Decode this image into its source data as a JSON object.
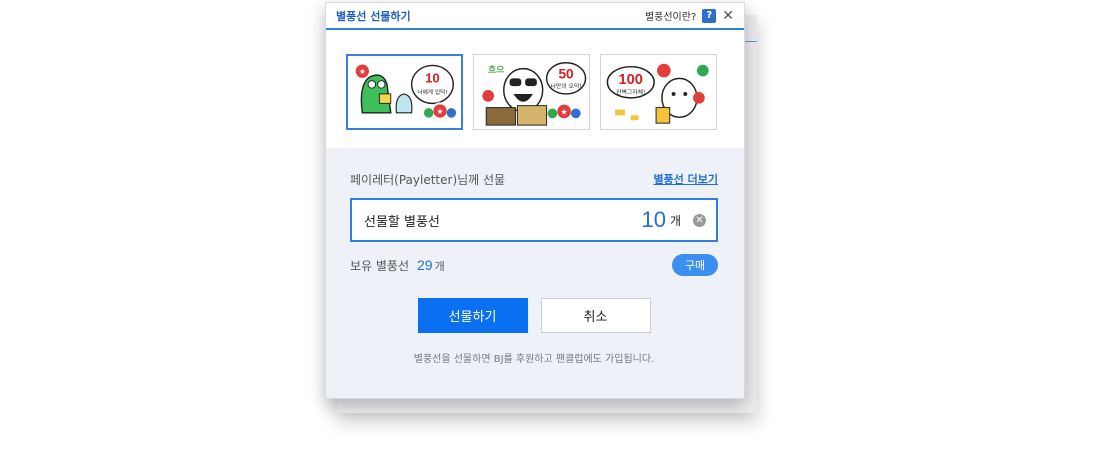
{
  "dialog": {
    "title": "별풍선 선물하기",
    "help_text": "별풍선이란?",
    "help_icon": "?",
    "close_icon": "✕"
  },
  "stickers": [
    {
      "count": "10",
      "caption": "너에게 입덕!",
      "selected": true
    },
    {
      "count": "50",
      "caption": "너만의 오덕!",
      "selected": false
    },
    {
      "count": "100",
      "caption": "완벽그자체!",
      "selected": false
    }
  ],
  "gift": {
    "recipient_label": "페이레터(Payletter)님께 선물",
    "more_link": "별풍선 더보기"
  },
  "input": {
    "label": "선물할 별풍선",
    "value": "10",
    "unit": "개",
    "clear_icon": "✕"
  },
  "owned": {
    "label": "보유 별풍선",
    "value": "29",
    "unit": "개",
    "buy_label": "구매"
  },
  "buttons": {
    "submit": "선물하기",
    "cancel": "취소"
  },
  "notice": "별풍선을 선물하면 BJ를 후원하고 팬클럽에도 가입됩니다.",
  "colors": {
    "accent": "#0b6ff2",
    "title": "#1f5fbd",
    "background": "#eef2f8"
  }
}
